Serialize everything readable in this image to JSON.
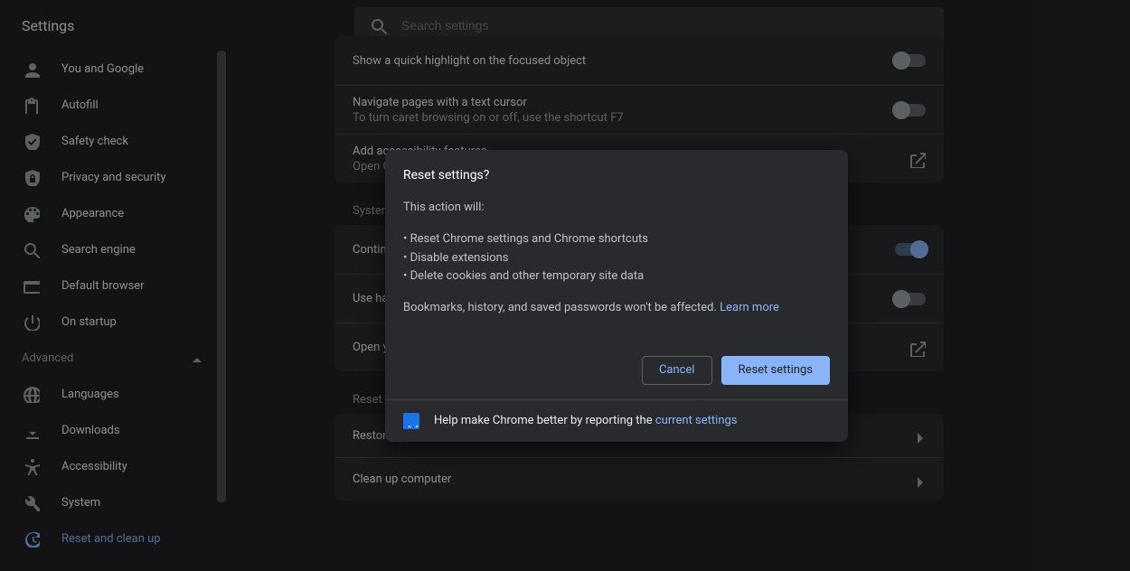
{
  "header": {
    "title": "Settings",
    "search_placeholder": "Search settings"
  },
  "sidebar": {
    "items": [
      {
        "icon": "person",
        "label": "You and Google"
      },
      {
        "icon": "clipboard",
        "label": "Autofill"
      },
      {
        "icon": "shield-check",
        "label": "Safety check"
      },
      {
        "icon": "lock",
        "label": "Privacy and security"
      },
      {
        "icon": "palette",
        "label": "Appearance"
      },
      {
        "icon": "search",
        "label": "Search engine"
      },
      {
        "icon": "browser",
        "label": "Default browser"
      },
      {
        "icon": "power",
        "label": "On startup"
      }
    ],
    "advanced_label": "Advanced",
    "advanced_items": [
      {
        "icon": "globe",
        "label": "Languages"
      },
      {
        "icon": "download",
        "label": "Downloads"
      },
      {
        "icon": "a11y",
        "label": "Accessibility"
      },
      {
        "icon": "wrench",
        "label": "System"
      },
      {
        "icon": "restore",
        "label": "Reset and clean up",
        "active": true
      }
    ]
  },
  "main": {
    "a11y_card": [
      {
        "title": "Show a quick highlight on the focused object",
        "sub": "",
        "ctrl": "toggle-off"
      },
      {
        "title": "Navigate pages with a text cursor",
        "sub": "To turn caret browsing on or off, use the shortcut F7",
        "ctrl": "toggle-off"
      },
      {
        "title": "Add accessibility features",
        "sub": "Open Chrome Web Store",
        "ctrl": "external"
      }
    ],
    "system_title": "System",
    "system_card": [
      {
        "title": "Continue running background apps when Google Chrome is closed",
        "ctrl": "toggle-on"
      },
      {
        "title": "Use hardware acceleration when available",
        "ctrl": "toggle-off"
      },
      {
        "title": "Open your computer's proxy settings",
        "ctrl": "external"
      }
    ],
    "reset_title": "Reset and clean up",
    "reset_card": [
      {
        "title": "Restore settings to their original defaults",
        "ctrl": "chevron"
      },
      {
        "title": "Clean up computer",
        "ctrl": "chevron"
      }
    ]
  },
  "dialog": {
    "title": "Reset settings?",
    "lead": "This action will:",
    "bullets": [
      "Reset Chrome settings and Chrome shortcuts",
      "Disable extensions",
      "Delete cookies and other temporary site data"
    ],
    "footer_line": "Bookmarks, history, and saved passwords won't be affected. ",
    "learn_more": "Learn more",
    "cancel": "Cancel",
    "confirm": "Reset settings",
    "report_prefix": "Help make Chrome better by reporting the ",
    "report_link": "current settings"
  }
}
